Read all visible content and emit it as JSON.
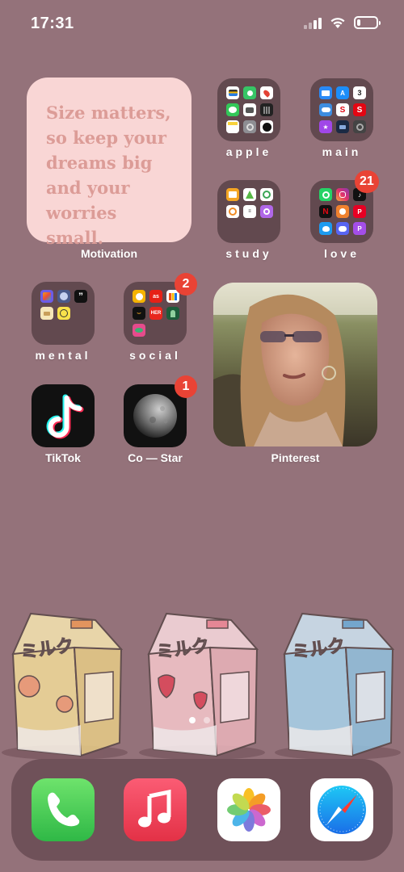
{
  "status_bar": {
    "time": "17:31",
    "signal_bars": 4,
    "signal_active": 2,
    "battery_level": 0.2
  },
  "widgets": {
    "quote": {
      "lines": [
        "Size matters,",
        "so keep your",
        "dreams big",
        "and your",
        "worries small."
      ],
      "label": "Motivation",
      "text_color": "#dc9c97",
      "background": "#f9d6d5"
    },
    "photo": {
      "label": "Pinterest"
    }
  },
  "folders": [
    {
      "label": "apple",
      "badge": ""
    },
    {
      "label": "main",
      "badge": ""
    },
    {
      "label": "study",
      "badge": ""
    },
    {
      "label": "love",
      "badge": "21"
    },
    {
      "label": "mental",
      "badge": ""
    },
    {
      "label": "social",
      "badge": "2"
    }
  ],
  "apps": [
    {
      "label": "TikTok",
      "badge": "",
      "icon": "tiktok-icon"
    },
    {
      "label": "Co — Star",
      "badge": "1",
      "icon": "moon-icon"
    }
  ],
  "mini_icons": {
    "main_calendar_day": "3",
    "social_her": "HER",
    "mental_quote": "”"
  },
  "milk_art": {
    "carton_text": "ミルク",
    "colors": [
      "#f3dc9a",
      "#f6c7cc",
      "#a9d4ec"
    ]
  },
  "page_dots": {
    "count": 2,
    "active": 0
  },
  "dock": [
    {
      "name": "Phone",
      "icon": "phone-icon"
    },
    {
      "name": "Music",
      "icon": "music-icon"
    },
    {
      "name": "Photos",
      "icon": "photos-icon"
    },
    {
      "name": "Safari",
      "icon": "safari-icon"
    }
  ],
  "colors": {
    "wallpaper": "#94727a",
    "folder": "#62494f",
    "badge": "#e94335"
  }
}
